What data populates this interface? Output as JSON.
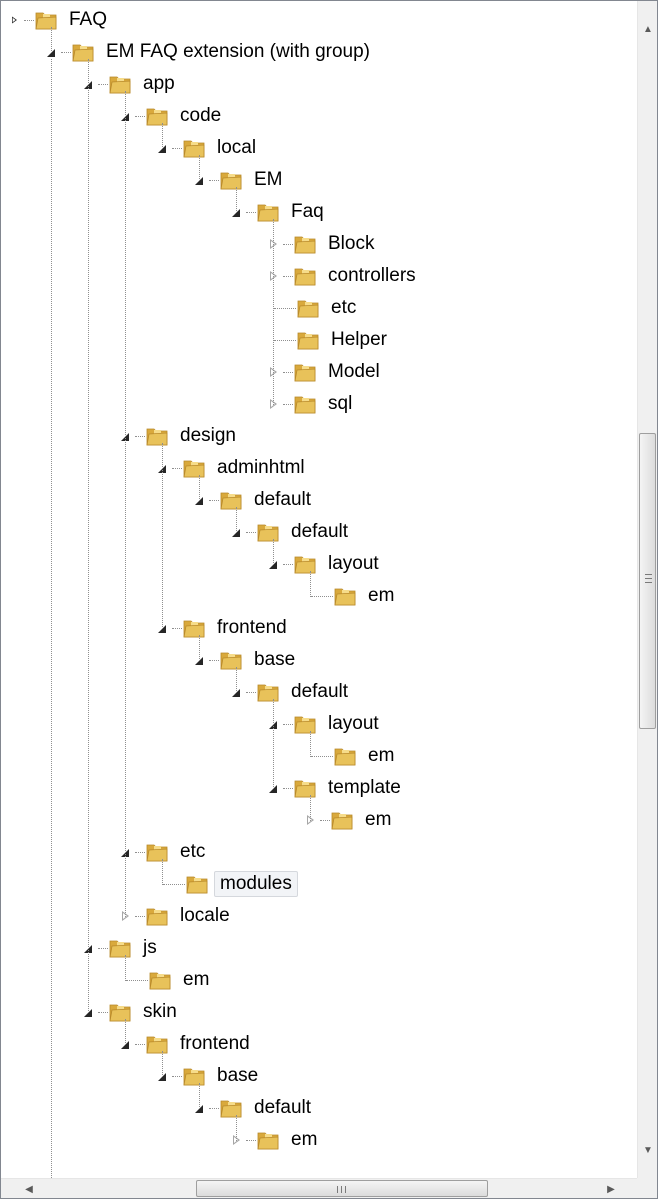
{
  "tree": {
    "nodes": [
      {
        "label": "FAQ",
        "depth": 0,
        "state": "expanded-root"
      },
      {
        "label": "EM FAQ extension (with group)",
        "depth": 1,
        "state": "expanded"
      },
      {
        "label": "app",
        "depth": 2,
        "state": "expanded"
      },
      {
        "label": "code",
        "depth": 3,
        "state": "expanded"
      },
      {
        "label": "local",
        "depth": 4,
        "state": "expanded"
      },
      {
        "label": "EM",
        "depth": 5,
        "state": "expanded"
      },
      {
        "label": "Faq",
        "depth": 6,
        "state": "expanded"
      },
      {
        "label": "Block",
        "depth": 7,
        "state": "collapsed"
      },
      {
        "label": "controllers",
        "depth": 7,
        "state": "collapsed"
      },
      {
        "label": "etc",
        "depth": 7,
        "state": "leaf"
      },
      {
        "label": "Helper",
        "depth": 7,
        "state": "leaf"
      },
      {
        "label": "Model",
        "depth": 7,
        "state": "collapsed"
      },
      {
        "label": "sql",
        "depth": 7,
        "state": "collapsed"
      },
      {
        "label": "design",
        "depth": 3,
        "state": "expanded"
      },
      {
        "label": "adminhtml",
        "depth": 4,
        "state": "expanded"
      },
      {
        "label": "default",
        "depth": 5,
        "state": "expanded"
      },
      {
        "label": "default",
        "depth": 6,
        "state": "expanded"
      },
      {
        "label": "layout",
        "depth": 7,
        "state": "expanded"
      },
      {
        "label": "em",
        "depth": 8,
        "state": "leaf"
      },
      {
        "label": "frontend",
        "depth": 4,
        "state": "expanded"
      },
      {
        "label": "base",
        "depth": 5,
        "state": "expanded"
      },
      {
        "label": "default",
        "depth": 6,
        "state": "expanded"
      },
      {
        "label": "layout",
        "depth": 7,
        "state": "expanded"
      },
      {
        "label": "em",
        "depth": 8,
        "state": "leaf"
      },
      {
        "label": "template",
        "depth": 7,
        "state": "expanded"
      },
      {
        "label": "em",
        "depth": 8,
        "state": "collapsed"
      },
      {
        "label": "etc",
        "depth": 3,
        "state": "expanded"
      },
      {
        "label": "modules",
        "depth": 4,
        "state": "leaf",
        "selected": true
      },
      {
        "label": "locale",
        "depth": 3,
        "state": "collapsed"
      },
      {
        "label": "js",
        "depth": 2,
        "state": "expanded"
      },
      {
        "label": "em",
        "depth": 3,
        "state": "leaf"
      },
      {
        "label": "skin",
        "depth": 2,
        "state": "expanded"
      },
      {
        "label": "frontend",
        "depth": 3,
        "state": "expanded"
      },
      {
        "label": "base",
        "depth": 4,
        "state": "expanded"
      },
      {
        "label": "default",
        "depth": 5,
        "state": "expanded"
      },
      {
        "label": "em",
        "depth": 6,
        "state": "collapsed"
      }
    ]
  },
  "scrollbars": {
    "vertical_up_glyph": "▲",
    "vertical_down_glyph": "▼",
    "horizontal_left_glyph": "◀",
    "horizontal_right_glyph": "▶",
    "grip_glyph": "≡",
    "hgrip_glyph": "III"
  },
  "colors": {
    "folder_body": "#e8c25a",
    "folder_tab": "#d9a93c",
    "folder_light": "#f6dc8a",
    "selection_bg": "#f2f4f7",
    "selection_border": "#d5d8dd"
  }
}
